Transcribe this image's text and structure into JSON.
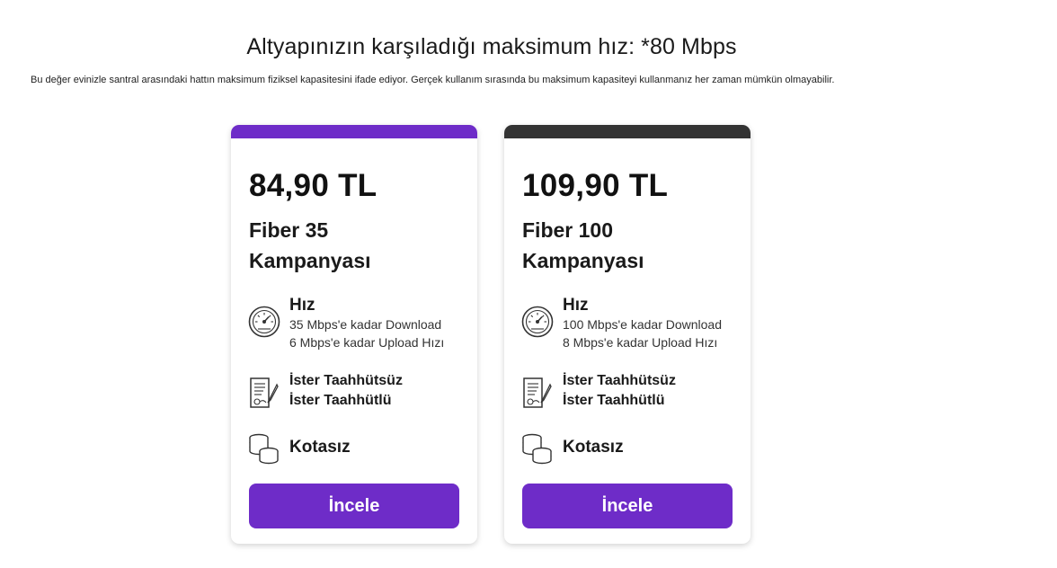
{
  "header": {
    "headline": "Altyapınızın karşıladığı maksimum hız: *80 Mbps",
    "subtext": "Bu değer evinizle santral arasındaki hattın maksimum fiziksel kapasitesini ifade ediyor. Gerçek kullanım sırasında bu maksimum kapasiteyi kullanmanız her zaman mümkün olmayabilir."
  },
  "colors": {
    "accent": "#6e2cc8",
    "card1_bar": "#6e2cc8",
    "card2_bar": "#333333"
  },
  "plans": [
    {
      "price": "84,90 TL",
      "name": "Fiber 35 Kampanyası",
      "speed_title": "Hız",
      "download": "35 Mbps'e kadar Download",
      "upload": "6 Mbps'e kadar Upload Hızı",
      "commit_1": "İster Taahhütsüz",
      "commit_2": "İster Taahhütlü",
      "quota": "Kotasız",
      "cta": "İncele"
    },
    {
      "price": "109,90 TL",
      "name": "Fiber 100 Kampanyası",
      "speed_title": "Hız",
      "download": "100 Mbps'e kadar Download",
      "upload": "8 Mbps'e kadar Upload Hızı",
      "commit_1": "İster Taahhütsüz",
      "commit_2": "İster Taahhütlü",
      "quota": "Kotasız",
      "cta": "İncele"
    }
  ],
  "icons": {
    "speed": "speedometer-icon",
    "contract": "contract-icon",
    "quota": "coins-stack-icon"
  }
}
